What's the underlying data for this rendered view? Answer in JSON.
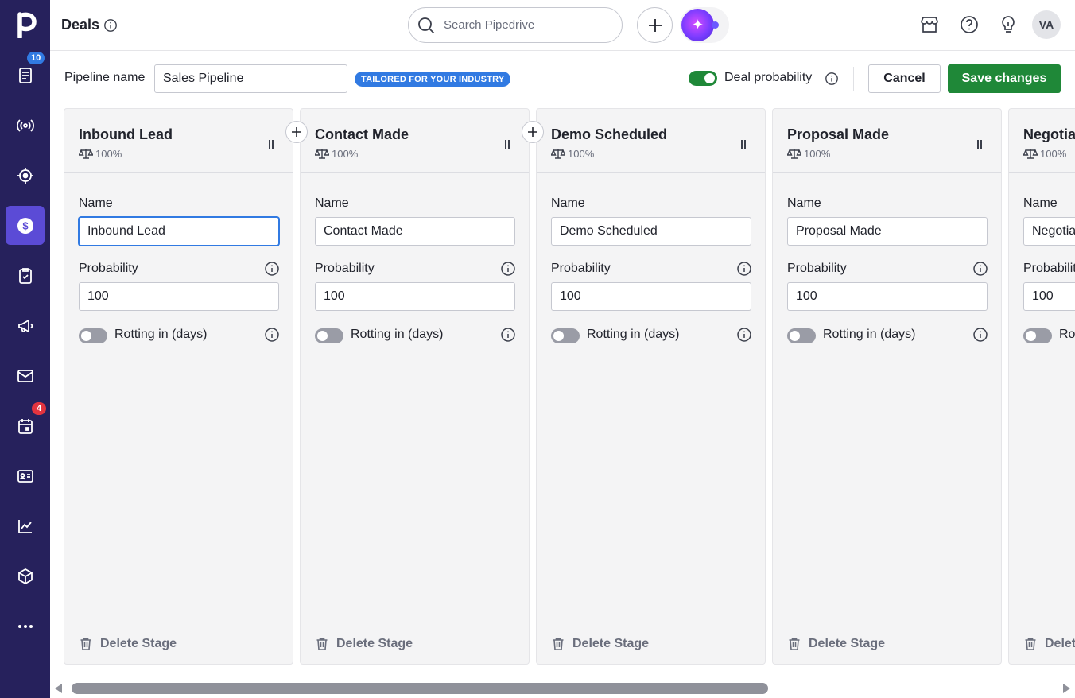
{
  "app": {
    "page_title": "Deals",
    "search": {
      "placeholder": "Search Pipedrive"
    },
    "user_initials": "VA"
  },
  "sidebar": {
    "items": [
      {
        "name": "leads",
        "icon": "leads-inbox-icon",
        "badge": "10"
      },
      {
        "name": "signals",
        "icon": "broadcast-icon"
      },
      {
        "name": "projects",
        "icon": "target-icon"
      },
      {
        "name": "deals",
        "icon": "dollar-icon",
        "active": true
      },
      {
        "name": "activities",
        "icon": "clipboard-check-icon"
      },
      {
        "name": "campaigns",
        "icon": "megaphone-icon"
      },
      {
        "name": "mail",
        "icon": "envelope-icon"
      },
      {
        "name": "calendar",
        "icon": "calendar-icon",
        "badge": "4"
      },
      {
        "name": "contacts",
        "icon": "contact-card-icon"
      },
      {
        "name": "insights",
        "icon": "chart-line-icon"
      },
      {
        "name": "products",
        "icon": "box-icon"
      },
      {
        "name": "more",
        "icon": "more-dots-icon"
      }
    ]
  },
  "toolbar": {
    "pipeline_label": "Pipeline name",
    "pipeline_value": "Sales Pipeline",
    "tailored_badge": "TAILORED FOR YOUR INDUSTRY",
    "deal_probability_label": "Deal probability",
    "deal_probability_enabled": true,
    "cancel_label": "Cancel",
    "save_label": "Save changes"
  },
  "labels": {
    "name": "Name",
    "probability": "Probability",
    "rotting": "Rotting in (days)",
    "delete": "Delete Stage"
  },
  "stages": [
    {
      "title": "Inbound Lead",
      "prob_display": "100%",
      "name_value": "Inbound Lead",
      "probability_value": "100"
    },
    {
      "title": "Contact Made",
      "prob_display": "100%",
      "name_value": "Contact Made",
      "probability_value": "100"
    },
    {
      "title": "Demo Scheduled",
      "prob_display": "100%",
      "name_value": "Demo Scheduled",
      "probability_value": "100"
    },
    {
      "title": "Proposal Made",
      "prob_display": "100%",
      "name_value": "Proposal Made",
      "probability_value": "100"
    },
    {
      "title": "Negotiations Started",
      "prob_display": "100%",
      "name_value": "Negotiations Started",
      "probability_value": "100"
    }
  ],
  "colors": {
    "sidebar_bg": "#26215c",
    "active_nav": "#5b4bd6",
    "primary_green": "#1f8838",
    "accent_blue": "#317ae2",
    "badge_red": "#e3343f"
  }
}
